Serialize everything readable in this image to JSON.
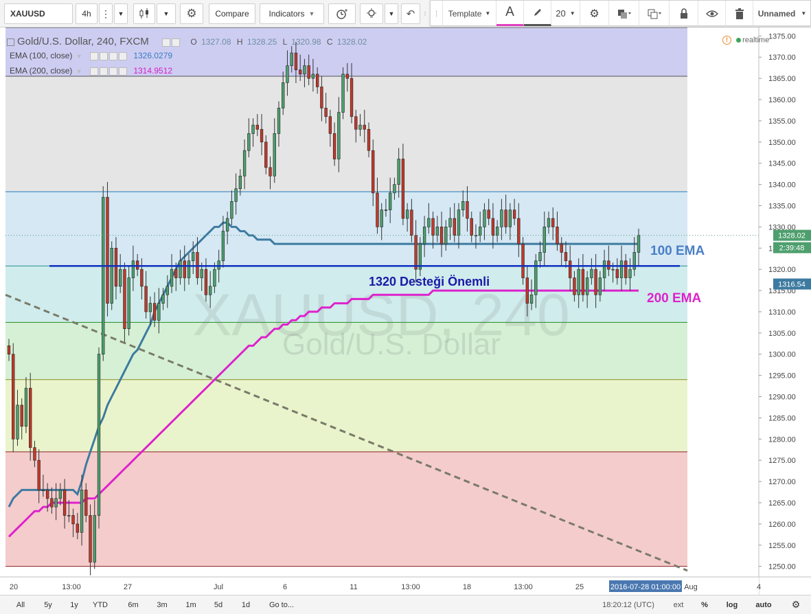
{
  "toolbar": {
    "symbol": "XAUUSD",
    "interval": "4h",
    "compare_label": "Compare",
    "indicators_label": "Indicators"
  },
  "floatbar": {
    "template_label": "Template",
    "text_tool": "A",
    "font_size": "20",
    "layout_name": "Unnamed"
  },
  "legend": {
    "title": "Gold/U.S. Dollar, 240, FXCM",
    "o_label": "O",
    "o_value": "1327.08",
    "h_label": "H",
    "h_value": "1328.25",
    "l_label": "L",
    "l_value": "1320.98",
    "c_label": "C",
    "c_value": "1328.02",
    "ema100_label": "EMA (100, close)",
    "ema100_value": "1326.0279",
    "ema200_label": "EMA (200, close)",
    "ema200_value": "1314.9512",
    "realtime": "realtime"
  },
  "watermark": {
    "symbol": "XAUUSD, 240",
    "name": "Gold/U.S. Dollar"
  },
  "annotations": {
    "support": "1320 Desteği Önemli",
    "ema100": "100 EMA",
    "ema200": "200 EMA"
  },
  "price_labels": {
    "last": "1328.02",
    "countdown": "2:39:48",
    "ema200": "1316.54"
  },
  "time_axis": {
    "labels": [
      "20",
      "13:00",
      "27",
      "Jul",
      "6",
      "11",
      "13:00",
      "18",
      "13:00",
      "25",
      "Aug",
      "4"
    ],
    "crosshair_label": "2016-07-28 01:00:00"
  },
  "bottombar": {
    "ranges": [
      "All",
      "5y",
      "1y",
      "YTD",
      "6m",
      "3m",
      "1m",
      "5d",
      "1d"
    ],
    "goto_label": "Go to...",
    "clock": "18:20:12 (UTC)",
    "ext": "ext",
    "percent": "%",
    "log": "log",
    "auto": "auto"
  },
  "chart_data": {
    "type": "candlestick",
    "symbol": "XAUUSD",
    "interval": "240",
    "price_axis": [
      1250,
      1255,
      1260,
      1265,
      1270,
      1275,
      1280,
      1285,
      1290,
      1295,
      1300,
      1305,
      1310,
      1315,
      1320,
      1325,
      1330,
      1335,
      1340,
      1345,
      1350,
      1355,
      1360,
      1365,
      1370,
      1375
    ],
    "ylim": [
      1248,
      1377
    ],
    "fib_levels": [
      1250.0,
      1277.0,
      1294.0,
      1307.5,
      1320.8,
      1338.3,
      1365.5,
      1377.0
    ],
    "fib_colors": [
      "#f4cccc",
      "#eaf4cc",
      "#d5f0d5",
      "#d0ecec",
      "#d5e8f4",
      "#e5e5e5",
      "#cdcdf2"
    ],
    "support_level": 1320.8,
    "closes": [
      1300,
      1280,
      1288,
      1283,
      1292,
      1278,
      1275,
      1268,
      1268,
      1266,
      1264,
      1266,
      1268,
      1262,
      1262,
      1260,
      1258,
      1268,
      1262,
      1251,
      1262,
      1300,
      1337,
      1312,
      1325,
      1316,
      1320,
      1306,
      1318,
      1322,
      1320,
      1316,
      1310,
      1312,
      1308,
      1312,
      1314,
      1316,
      1320,
      1318,
      1322,
      1318,
      1322,
      1324,
      1318,
      1320,
      1314,
      1316,
      1320,
      1322,
      1329,
      1332,
      1336,
      1339,
      1342,
      1348,
      1352,
      1354,
      1353,
      1350,
      1344,
      1342,
      1352,
      1358,
      1364,
      1368,
      1371,
      1367,
      1366,
      1368,
      1365,
      1366,
      1363,
      1358,
      1356,
      1352,
      1346,
      1357,
      1366,
      1365,
      1356,
      1353,
      1354,
      1353,
      1348,
      1338,
      1330,
      1334,
      1334,
      1338,
      1340,
      1346,
      1332,
      1334,
      1328,
      1320,
      1326,
      1330,
      1332,
      1328,
      1330,
      1326,
      1330,
      1332,
      1328,
      1334,
      1336,
      1332,
      1328,
      1328,
      1330,
      1334,
      1332,
      1328,
      1330,
      1334,
      1330,
      1334,
      1332,
      1326,
      1318,
      1312,
      1314,
      1322,
      1324,
      1330,
      1332,
      1330,
      1326,
      1324,
      1322,
      1318,
      1314,
      1320,
      1314,
      1318,
      1320,
      1314,
      1318,
      1322,
      1320,
      1320,
      1318,
      1322,
      1318,
      1320,
      1324,
      1328
    ],
    "ema100": [
      1264,
      1266,
      1267,
      1268,
      1268,
      1268,
      1268,
      1268,
      1268,
      1268,
      1268,
      1268,
      1268,
      1268,
      1268,
      1268,
      1267,
      1270,
      1274,
      1277,
      1280,
      1283,
      1285,
      1288,
      1290,
      1292,
      1294,
      1296,
      1298,
      1300,
      1301,
      1303,
      1305,
      1307,
      1310,
      1312,
      1314,
      1316,
      1318,
      1320,
      1322,
      1323,
      1324,
      1325,
      1326,
      1327,
      1328,
      1329,
      1330,
      1330,
      1331,
      1331,
      1330,
      1330,
      1329,
      1329,
      1328,
      1328,
      1327,
      1327,
      1327,
      1327,
      1326,
      1326,
      1326,
      1326,
      1326,
      1326,
      1326,
      1326,
      1326,
      1326,
      1326,
      1326,
      1326,
      1326,
      1326,
      1326,
      1326,
      1326,
      1326,
      1326,
      1326,
      1326,
      1326,
      1326,
      1326,
      1326,
      1326,
      1326,
      1326,
      1326,
      1326,
      1326,
      1326,
      1326,
      1326,
      1326,
      1326,
      1326,
      1326,
      1326,
      1326,
      1326,
      1326,
      1326,
      1326,
      1326,
      1326,
      1326,
      1326,
      1326,
      1326,
      1326,
      1326,
      1326,
      1326,
      1326,
      1326,
      1326,
      1326,
      1326,
      1326,
      1326,
      1326,
      1326,
      1326,
      1326,
      1326,
      1326,
      1326,
      1326,
      1326,
      1326,
      1326,
      1326,
      1326,
      1326,
      1326,
      1326,
      1326,
      1326,
      1326,
      1326,
      1326,
      1326,
      1326,
      1326
    ],
    "ema200": [
      1257,
      1258,
      1259,
      1260,
      1261,
      1262,
      1263,
      1263,
      1264,
      1264,
      1265,
      1265,
      1265,
      1265,
      1265,
      1265,
      1265,
      1265,
      1266,
      1266,
      1266,
      1267,
      1268,
      1269,
      1270,
      1271,
      1272,
      1273,
      1274,
      1275,
      1276,
      1277,
      1278,
      1279,
      1280,
      1281,
      1282,
      1283,
      1284,
      1285,
      1286,
      1287,
      1288,
      1289,
      1290,
      1291,
      1292,
      1293,
      1294,
      1295,
      1296,
      1297,
      1298,
      1299,
      1300,
      1301,
      1302,
      1302,
      1303,
      1304,
      1304,
      1305,
      1306,
      1306,
      1307,
      1307,
      1308,
      1308,
      1309,
      1309,
      1310,
      1310,
      1310,
      1311,
      1311,
      1311,
      1312,
      1312,
      1312,
      1312,
      1313,
      1313,
      1313,
      1313,
      1313,
      1314,
      1314,
      1314,
      1314,
      1314,
      1314,
      1314,
      1314,
      1314,
      1314,
      1314,
      1314,
      1314,
      1314,
      1315,
      1315,
      1315,
      1315,
      1315,
      1315,
      1315,
      1315,
      1315,
      1315,
      1315,
      1315,
      1315,
      1315,
      1315,
      1315,
      1315,
      1315,
      1315,
      1315,
      1315,
      1315,
      1315,
      1315,
      1315,
      1315,
      1315,
      1315,
      1315,
      1315,
      1315,
      1315,
      1315,
      1315,
      1315,
      1315,
      1315,
      1315,
      1315,
      1315,
      1315,
      1315,
      1315,
      1315,
      1315,
      1315,
      1315,
      1315,
      1315
    ],
    "trendline": {
      "from": [
        0,
        1314
      ],
      "to": [
        1,
        1249
      ]
    },
    "last_price": 1328.02
  }
}
